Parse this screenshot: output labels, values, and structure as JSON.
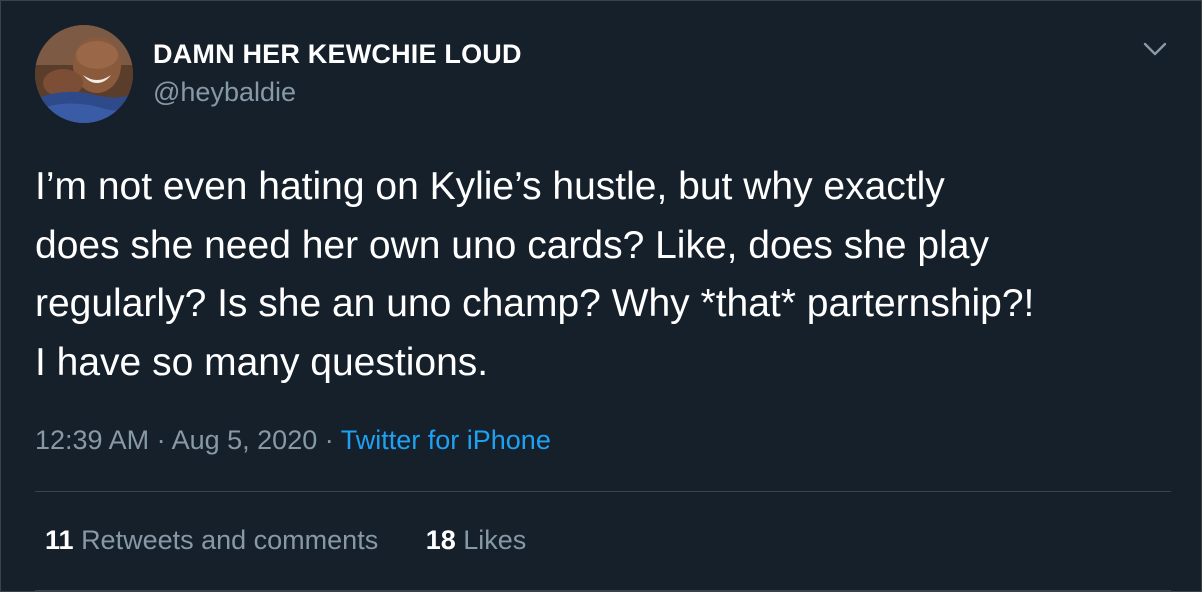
{
  "user": {
    "display_name": "DAMN HER KEWCHIE LOUD",
    "handle": "@heybaldie"
  },
  "tweet": {
    "text": "I’m not even hating on Kylie’s hustle, but why exactly\ndoes she need her own uno cards? Like, does she play\nregularly? Is she an uno champ? Why *that* parternship?!\nI have so many questions.",
    "time": "12:39 AM",
    "separator": " · ",
    "date": "Aug 5, 2020",
    "source": "Twitter for iPhone"
  },
  "stats": {
    "retweets_count": "11",
    "retweets_label": "Retweets and comments",
    "likes_count": "18",
    "likes_label": "Likes"
  },
  "icons": {
    "menu": "chevron-down-icon",
    "avatar": "avatar-photo"
  },
  "colors": {
    "background": "#15202b",
    "text": "#ffffff",
    "secondary_text": "#8899a6",
    "link": "#1da1f2",
    "border": "#38444d"
  }
}
